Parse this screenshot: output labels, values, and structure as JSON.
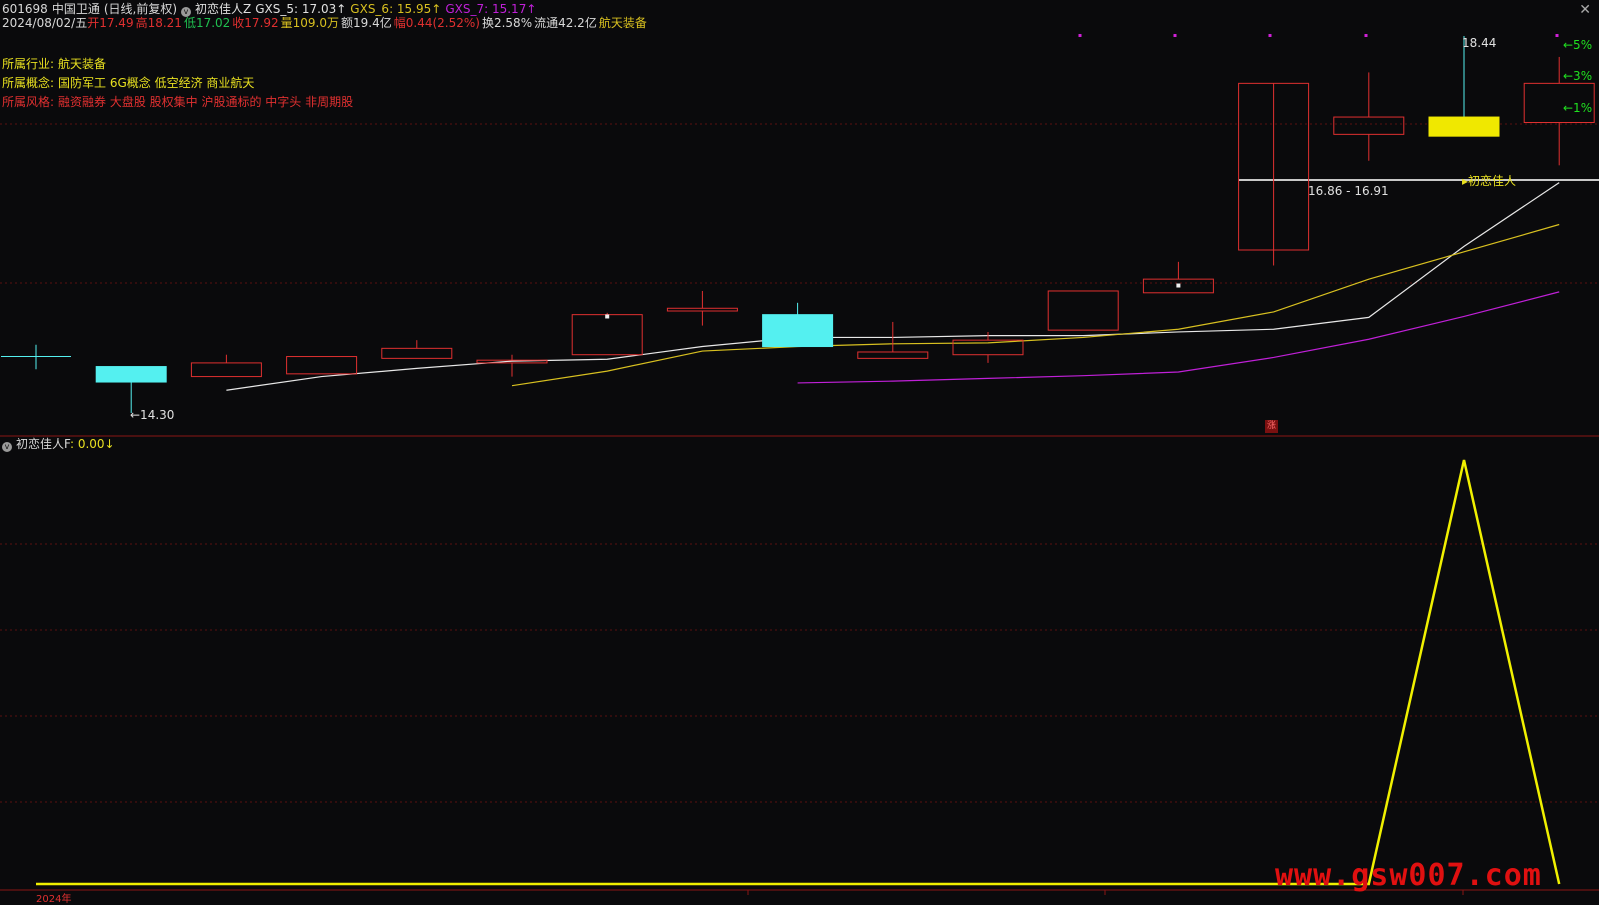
{
  "header": {
    "code": "601698",
    "name": "中国卫通",
    "mode": "(日线,前复权)",
    "indicator": "初恋佳人Z",
    "gxs5_label": "GXS_5: 17.03↑",
    "gxs6_label": "GXS_6: 15.95↑",
    "gxs7_label": "GXS_7: 15.17↑"
  },
  "quote": {
    "date": "2024/08/02/五",
    "open": "开17.49",
    "high": "高18.21",
    "low": "低17.02",
    "close": "收17.92",
    "volume": "量109.0万",
    "amount": "额19.4亿",
    "change": "幅0.44(2.52%)",
    "turnover": "换2.58%",
    "float_cap": "流通42.2亿",
    "sector": "航天装备"
  },
  "info": {
    "industry_label": "所属行业:",
    "industry": "航天装备",
    "concept_label": "所属概念:",
    "concepts": "国防军工 6G概念 低空经济 商业航天",
    "style_label": "所属风格:",
    "styles": "融资融券 大盘股 股权集中 沪股通标的 中字头 非周期股"
  },
  "annotations": {
    "high_marker": "18.44",
    "low_marker": "←14.30",
    "zone": "16.86 - 16.91",
    "signal": "▸初恋佳人",
    "pct5": "←5%",
    "pct3": "←3%",
    "pct1": "←1%",
    "zhang": "涨"
  },
  "sub_header": {
    "label": "初恋佳人F",
    "value": ": 0.00↓"
  },
  "footer": {
    "year": "2024年"
  },
  "watermark": "www.gsw007.com",
  "colors": {
    "up": "#e03030",
    "down": "#54f0f0",
    "gxs5": "#e8e8e8",
    "gxs6": "#d8c020",
    "gxs7": "#c020d8",
    "signal_line": "#f0f000"
  },
  "chart_data": [
    {
      "type": "candlestick",
      "candles": [
        {
          "o": 14.92,
          "h": 15.05,
          "l": 14.78,
          "c": 14.92
        },
        {
          "o": 14.81,
          "h": 14.81,
          "l": 14.3,
          "c": 14.64
        },
        {
          "o": 14.7,
          "h": 14.94,
          "l": 14.7,
          "c": 14.85
        },
        {
          "o": 14.73,
          "h": 14.92,
          "l": 14.73,
          "c": 14.92
        },
        {
          "o": 14.9,
          "h": 15.1,
          "l": 14.9,
          "c": 15.01
        },
        {
          "o": 14.85,
          "h": 14.94,
          "l": 14.7,
          "c": 14.88
        },
        {
          "o": 14.94,
          "h": 15.4,
          "l": 14.94,
          "c": 15.38
        },
        {
          "o": 15.42,
          "h": 15.64,
          "l": 15.26,
          "c": 15.45
        },
        {
          "o": 15.38,
          "h": 15.51,
          "l": 15.03,
          "c": 15.03
        },
        {
          "o": 14.9,
          "h": 15.3,
          "l": 14.9,
          "c": 14.97
        },
        {
          "o": 14.94,
          "h": 15.19,
          "l": 14.85,
          "c": 15.1
        },
        {
          "o": 15.21,
          "h": 15.64,
          "l": 15.21,
          "c": 15.64
        },
        {
          "o": 15.62,
          "h": 15.96,
          "l": 15.62,
          "c": 15.77
        },
        {
          "o": 16.09,
          "h": 16.09,
          "l": 15.92,
          "c": 17.92
        },
        {
          "o": 17.36,
          "h": 18.04,
          "l": 17.07,
          "c": 17.55
        },
        {
          "o": 17.55,
          "h": 18.44,
          "l": 17.37,
          "c": 17.34
        },
        {
          "o": 17.49,
          "h": 18.21,
          "l": 17.02,
          "c": 17.92
        }
      ],
      "gxs5": [
        14.55,
        14.7,
        14.79,
        14.87,
        14.89,
        15.03,
        15.13,
        15.13,
        15.15,
        15.15,
        15.19,
        15.22,
        15.35,
        16.13,
        16.83
      ],
      "gxs6": [
        14.6,
        14.76,
        14.98,
        15.03,
        15.06,
        15.07,
        15.13,
        15.22,
        15.41,
        15.77,
        16.07,
        16.37
      ],
      "gxs7": [
        14.63,
        14.65,
        14.68,
        14.71,
        14.75,
        14.91,
        15.11,
        15.36,
        15.63
      ],
      "zone": [
        16.86,
        16.91
      ]
    },
    {
      "type": "line",
      "name": "初恋佳人F",
      "values": [
        0,
        0,
        0,
        0,
        0,
        0,
        0,
        0,
        0,
        0,
        0,
        0,
        0,
        0,
        0,
        1,
        0
      ]
    }
  ]
}
